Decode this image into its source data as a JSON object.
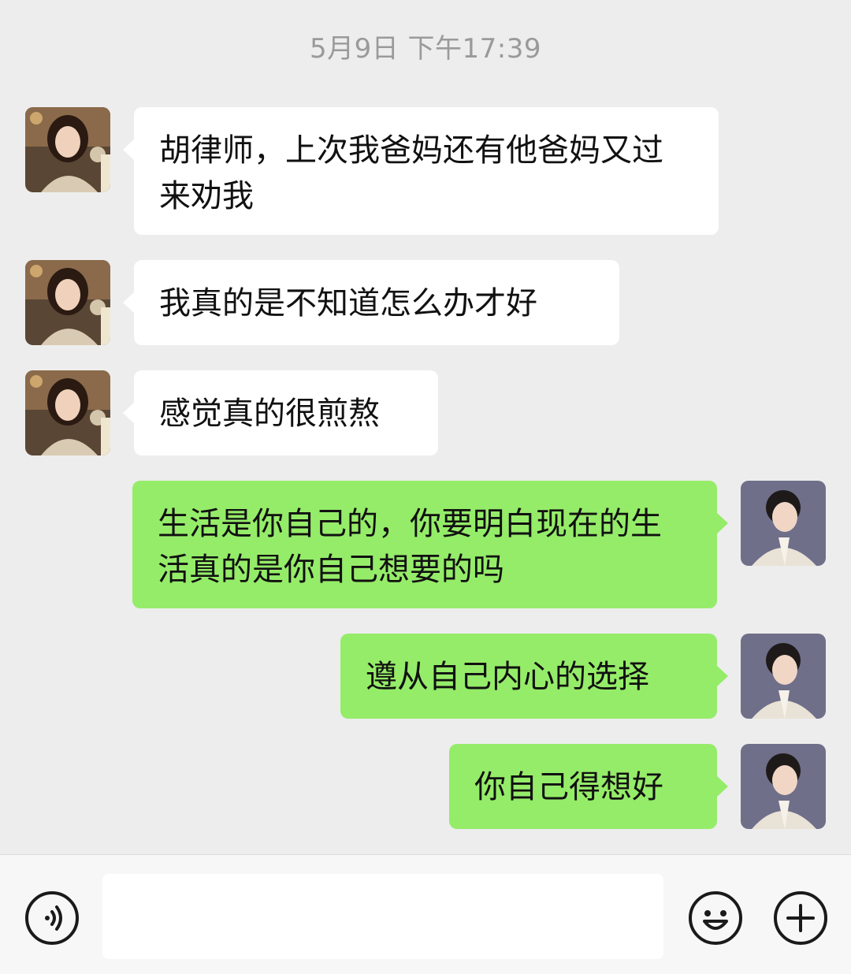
{
  "timestamp": "5月9日 下午17:39",
  "messages": [
    {
      "side": "in",
      "text": "胡律师，上次我爸妈还有他爸妈又过来劝我"
    },
    {
      "side": "in",
      "text": "我真的是不知道怎么办才好"
    },
    {
      "side": "in",
      "text": "感觉真的很煎熬"
    },
    {
      "side": "out",
      "text": "生活是你自己的，你要明白现在的生活真的是你自己想要的吗"
    },
    {
      "side": "out",
      "text": "遵从自己内心的选择"
    },
    {
      "side": "out",
      "text": "你自己得想好"
    }
  ],
  "input": {
    "value": "",
    "placeholder": ""
  },
  "icons": {
    "voice": "voice-icon",
    "emoji": "emoji-icon",
    "plus": "plus-icon"
  },
  "colors": {
    "background": "#ededed",
    "incoming_bubble": "#ffffff",
    "outgoing_bubble": "#95ec69",
    "timestamp": "#9a9a9a"
  }
}
